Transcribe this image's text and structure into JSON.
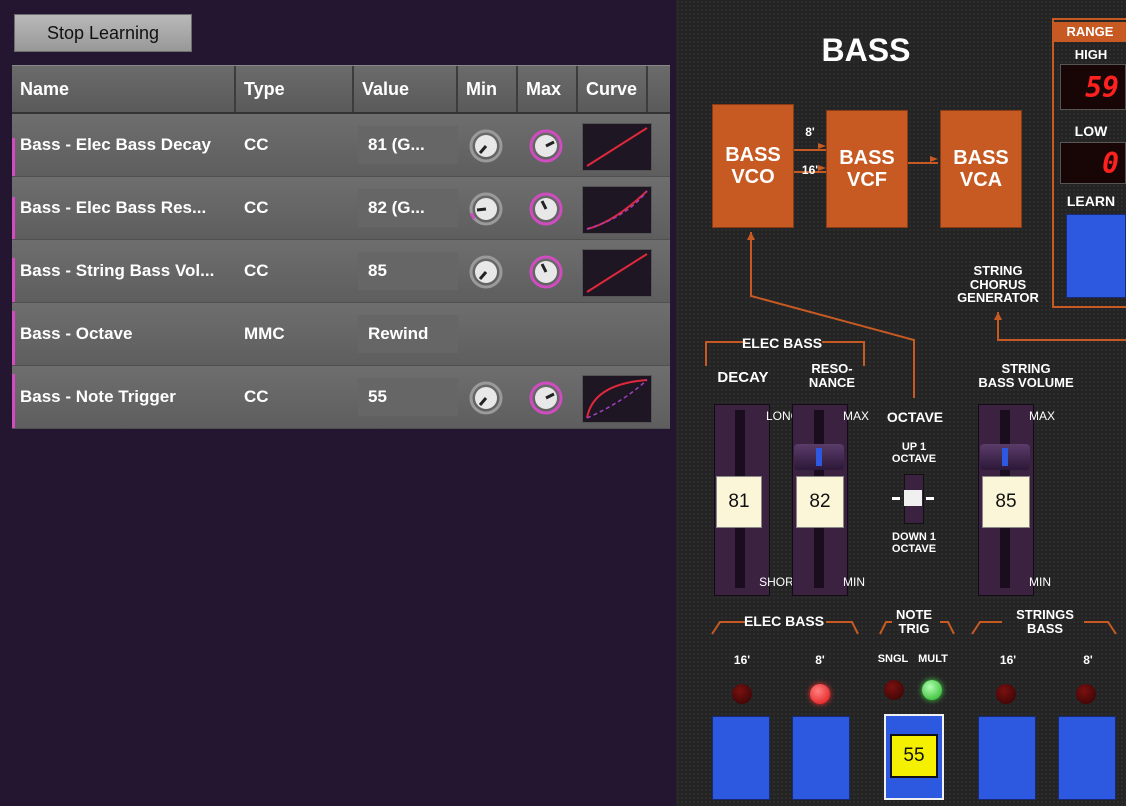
{
  "toolbar": {
    "stop_label": "Stop Learning"
  },
  "table": {
    "columns": [
      "Name",
      "Type",
      "Value",
      "Min",
      "Max",
      "Curve"
    ],
    "rows": [
      {
        "name": "Bass - Elec Bass Decay",
        "type": "CC",
        "value": "81 (G..."
      },
      {
        "name": "Bass - Elec Bass Res...",
        "type": "CC",
        "value": "82 (G..."
      },
      {
        "name": "Bass - String Bass Vol...",
        "type": "CC",
        "value": "85"
      },
      {
        "name": "Bass - Octave",
        "type": "MMC",
        "value": "Rewind"
      },
      {
        "name": "Bass - Note Trigger",
        "type": "CC",
        "value": "55"
      }
    ]
  },
  "synth": {
    "title": "BASS",
    "range": {
      "title": "RANGE",
      "high_label": "HIGH",
      "high_value": "59",
      "low_label": "LOW",
      "low_value": "0",
      "learn_label": "LEARN"
    },
    "vco": {
      "l1": "BASS",
      "l2": "VCO"
    },
    "vcf": {
      "l1": "BASS",
      "l2": "VCF"
    },
    "vca": {
      "l1": "BASS",
      "l2": "VCA"
    },
    "feet_8": "8'",
    "feet_16": "16'",
    "string_chorus": {
      "l1": "STRING",
      "l2": "CHORUS",
      "l3": "GENERATOR"
    },
    "elec_bass_group": "ELEC BASS",
    "decay": {
      "label": "DECAY",
      "top": "LONG",
      "bottom": "SHORT",
      "value": "81"
    },
    "resonance": {
      "l1": "RESO-",
      "l2": "NANCE",
      "top": "MAX",
      "bottom": "MIN",
      "value": "82"
    },
    "octave": {
      "label": "OCTAVE",
      "up1": "UP 1",
      "up2": "OCTAVE",
      "down1": "DOWN 1",
      "down2": "OCTAVE"
    },
    "string_bass_volume": {
      "l1": "STRING",
      "l2": "BASS VOLUME",
      "top": "MAX",
      "bottom": "MIN",
      "value": "85"
    },
    "bottom": {
      "elec_bass": "ELEC BASS",
      "note_trig1": "NOTE",
      "note_trig2": "TRIG",
      "strings_bass1": "STRINGS",
      "strings_bass2": "BASS",
      "f16": "16'",
      "f8": "8'",
      "sngl": "SNGL",
      "mult": "MULT",
      "trig_value": "55"
    }
  },
  "colors": {
    "accent": "#d04cc0",
    "module": "#c65a22",
    "learn": "#2d58e0",
    "led_on_red": "#ff2020",
    "led_on_green": "#33cc33"
  }
}
